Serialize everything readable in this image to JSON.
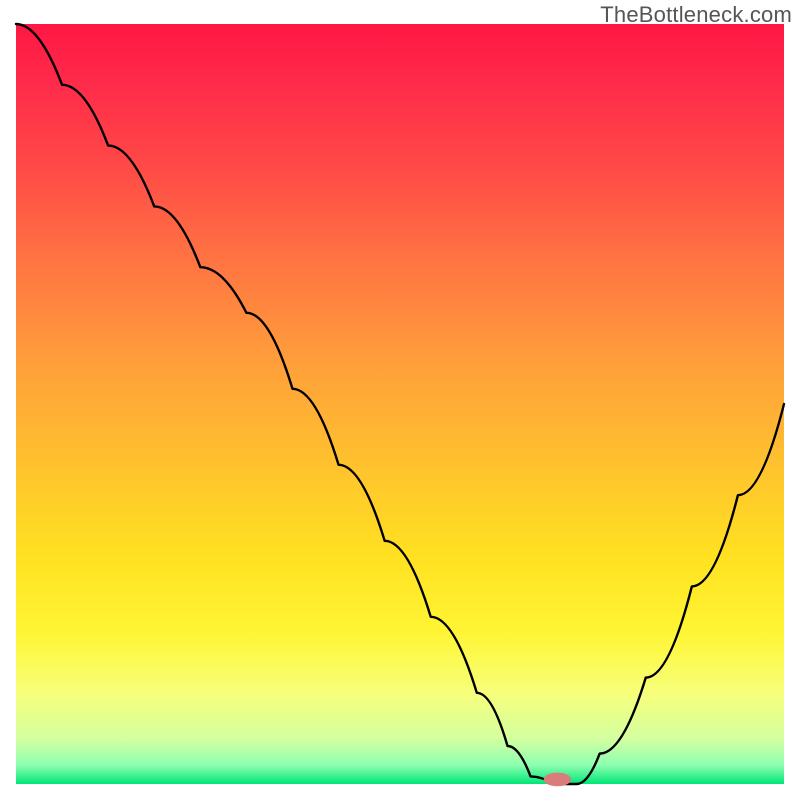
{
  "watermark": "TheBottleneck.com",
  "colors": {
    "gradient_stops": [
      {
        "offset": 0.0,
        "color": "#ff1744"
      },
      {
        "offset": 0.08,
        "color": "#ff2b4a"
      },
      {
        "offset": 0.18,
        "color": "#ff4747"
      },
      {
        "offset": 0.3,
        "color": "#ff7043"
      },
      {
        "offset": 0.45,
        "color": "#ffa03a"
      },
      {
        "offset": 0.58,
        "color": "#ffc22e"
      },
      {
        "offset": 0.7,
        "color": "#ffe121"
      },
      {
        "offset": 0.8,
        "color": "#fff534"
      },
      {
        "offset": 0.88,
        "color": "#f7ff7a"
      },
      {
        "offset": 0.94,
        "color": "#d4ffa0"
      },
      {
        "offset": 0.975,
        "color": "#8effb0"
      },
      {
        "offset": 1.0,
        "color": "#00e676"
      }
    ],
    "curve": "#000000",
    "frame": "#ffffff",
    "marker": "#d97c7c"
  },
  "chart_data": {
    "type": "line",
    "title": "",
    "xlabel": "",
    "ylabel": "",
    "xlim": [
      0,
      100
    ],
    "ylim": [
      0,
      100
    ],
    "grid": false,
    "legend": false,
    "note": "V-shaped bottleneck curve over red-to-green vertical gradient; minimum near x≈70.",
    "series": [
      {
        "name": "bottleneck-curve",
        "x": [
          0,
          6,
          12,
          18,
          24,
          30,
          36,
          42,
          48,
          54,
          60,
          64,
          67,
          70,
          73,
          76,
          82,
          88,
          94,
          100
        ],
        "y": [
          100,
          92,
          84,
          76,
          68,
          62,
          52,
          42,
          32,
          22,
          12,
          5,
          1,
          0,
          0,
          4,
          14,
          26,
          38,
          50
        ]
      }
    ],
    "marker": {
      "x": 70.5,
      "y": 0.6,
      "rx": 1.8,
      "ry": 0.9
    }
  }
}
